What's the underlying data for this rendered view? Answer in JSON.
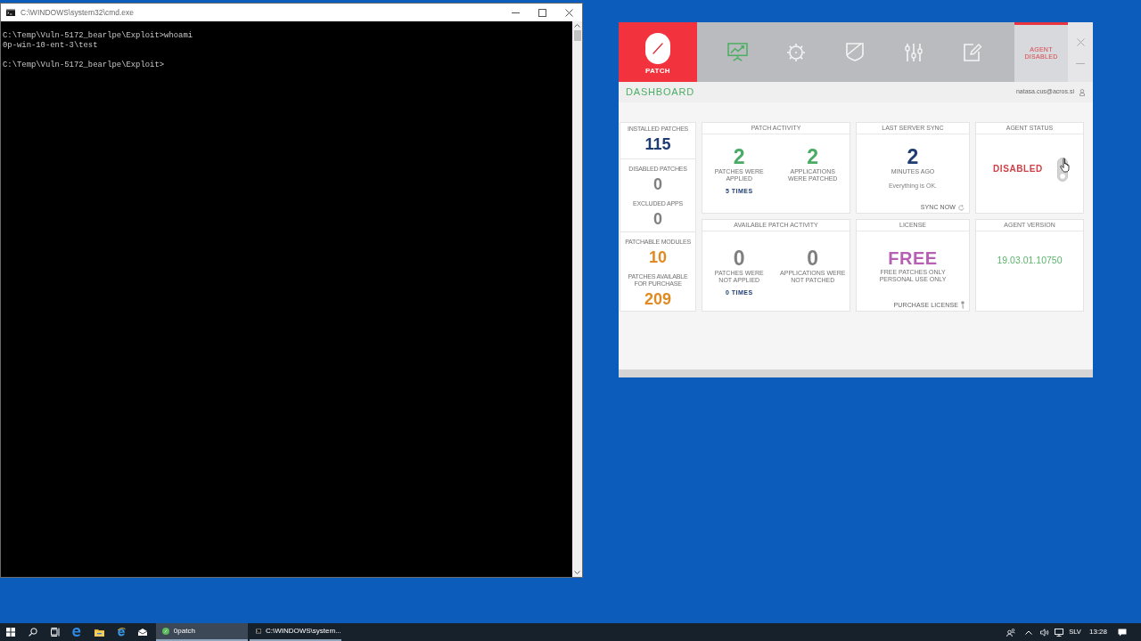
{
  "console_window": {
    "title": "C:\\WINDOWS\\system32\\cmd.exe",
    "blocks": [
      [
        "C:\\Temp\\Vuln-5172_bearlpe\\Exploit>whoami",
        "0p-win-10-ent-3\\test"
      ],
      [
        "C:\\Temp\\Vuln-5172_bearlpe\\Exploit>"
      ]
    ]
  },
  "agent_window": {
    "logo": "PATCH",
    "nav": [
      {
        "selected": true
      },
      {
        "selected": false
      },
      {
        "selected": false
      },
      {
        "selected": false
      },
      {
        "selected": false
      }
    ],
    "status_tab": "AGENT DISABLED",
    "page_title": "DASHBOARD",
    "user": "natasa.cus@acros.si",
    "summary_groups": [
      [
        {
          "label": "INSTALLED PATCHES",
          "value": "115",
          "color": "#1f3d72"
        }
      ],
      [
        {
          "label": "DISABLED PATCHES",
          "value": "0",
          "color": "#7f7f7f"
        },
        {
          "label": "EXCLUDED APPS",
          "value": "0",
          "color": "#7f7f7f"
        }
      ],
      [
        {
          "label": "PATCHABLE MODULES",
          "value": "10",
          "color": "#e08a22"
        },
        {
          "label": "PATCHES AVAILABLE FOR PURCHASE",
          "value": "209",
          "color": "#e08a22"
        }
      ]
    ],
    "cards": [
      {
        "kind": "activity",
        "title": "PATCH ACTIVITY",
        "color": "#4aab65",
        "stats": [
          {
            "value": "2",
            "label": [
              "PATCHES WERE",
              "APPLIED"
            ]
          },
          {
            "value": "2",
            "label": [
              "APPLICATIONS",
              "WERE PATCHED"
            ]
          }
        ],
        "count": "5 TIMES"
      },
      {
        "kind": "sync",
        "title": "LAST SERVER SYNC",
        "value": "2",
        "unit": "MINUTES AGO",
        "message": "Everything is OK.",
        "action": "SYNC NOW"
      },
      {
        "kind": "status",
        "title": "AGENT STATUS",
        "value": "DISABLED",
        "on": false
      },
      {
        "kind": "activity",
        "title": "AVAILABLE PATCH ACTIVITY",
        "color": "#7f7f7f",
        "stats": [
          {
            "value": "0",
            "label": [
              "PATCHES WERE",
              "NOT APPLIED"
            ]
          },
          {
            "value": "0",
            "label": [
              "APPLICATIONS WERE",
              "NOT PATCHED"
            ]
          }
        ],
        "count": "0 TIMES"
      },
      {
        "kind": "license",
        "title": "LICENSE",
        "value": "FREE",
        "notes": [
          "FREE PATCHES ONLY",
          "PERSONAL USE ONLY"
        ],
        "action": "PURCHASE LICENSE"
      },
      {
        "kind": "version",
        "title": "AGENT VERSION",
        "value": "19.03.01.10750"
      }
    ]
  },
  "taskbar": {
    "apps": [
      {
        "label": "0patch",
        "selected": true
      },
      {
        "label": "C:\\WINDOWS\\system...",
        "selected": false
      }
    ],
    "language": "SLV",
    "time": "13:28"
  }
}
